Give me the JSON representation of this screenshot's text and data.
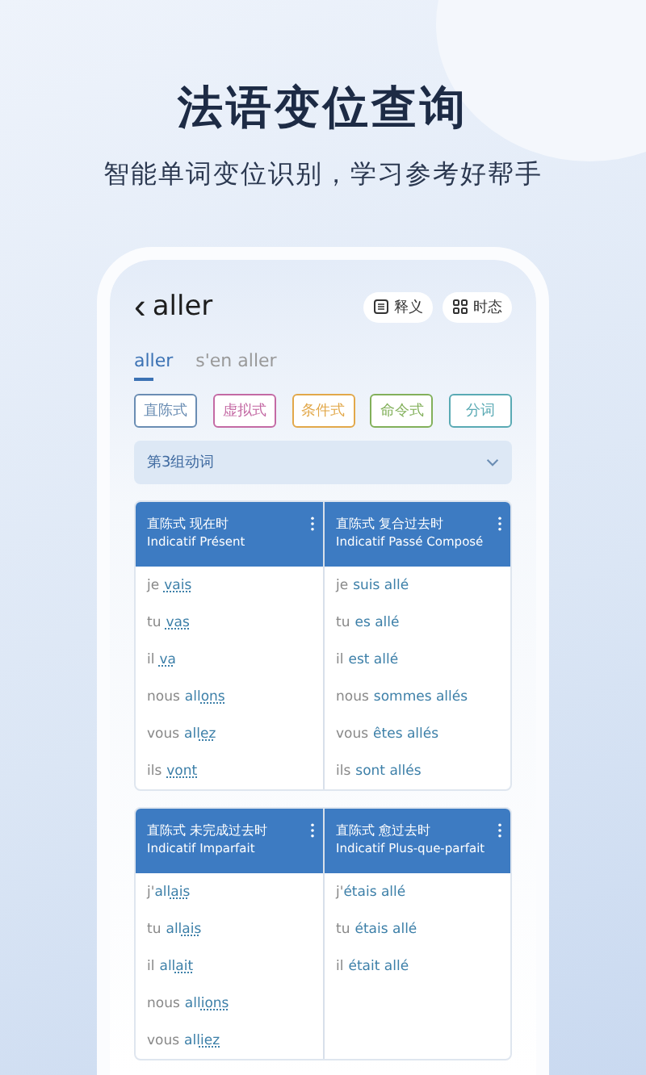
{
  "headline": "法语变位查询",
  "subtitle": "智能单词变位识别，学习参考好帮手",
  "screen": {
    "back_icon": "‹",
    "verb": "aller",
    "actions": [
      {
        "label": "释义"
      },
      {
        "label": "时态"
      }
    ],
    "tabs": [
      {
        "label": "aller",
        "selected": true
      },
      {
        "label": "s'en aller",
        "selected": false
      }
    ],
    "moods": [
      {
        "label": "直陈式",
        "color": "#6a8db3"
      },
      {
        "label": "虚拟式",
        "color": "#c46aa4"
      },
      {
        "label": "条件式",
        "color": "#e2a84a"
      },
      {
        "label": "命令式",
        "color": "#82b05a"
      },
      {
        "label": "分词",
        "color": "#5aaab4"
      }
    ],
    "group_select": {
      "value": "第3组动词"
    },
    "tables": [
      {
        "columns": [
          {
            "title_zh": "直陈式 现在时",
            "title_fr": "Indicatif Présent",
            "forms": [
              {
                "pronoun": "je",
                "ending": "vais"
              },
              {
                "pronoun": "tu",
                "ending": "vas"
              },
              {
                "pronoun": "il",
                "ending": "va"
              },
              {
                "pronoun": "nous",
                "stem": "all",
                "ending": "ons"
              },
              {
                "pronoun": "vous",
                "stem": "all",
                "ending": "ez"
              },
              {
                "pronoun": "ils",
                "ending": "vont"
              }
            ]
          },
          {
            "title_zh": "直陈式 复合过去时",
            "title_fr": "Indicatif Passé Composé",
            "forms": [
              {
                "pronoun": "je",
                "stem": "suis allé"
              },
              {
                "pronoun": "tu",
                "stem": "es allé"
              },
              {
                "pronoun": "il",
                "stem": "est allé"
              },
              {
                "pronoun": "nous",
                "stem": "sommes allés"
              },
              {
                "pronoun": "vous",
                "stem": "êtes allés"
              },
              {
                "pronoun": "ils",
                "stem": "sont allés"
              }
            ]
          }
        ]
      },
      {
        "columns": [
          {
            "title_zh": "直陈式 未完成过去时",
            "title_fr": "Indicatif Imparfait",
            "forms": [
              {
                "pronoun": "j'",
                "joined": true,
                "stem": "all",
                "ending": "ais"
              },
              {
                "pronoun": "tu",
                "stem": "all",
                "ending": "ais"
              },
              {
                "pronoun": "il",
                "stem": "all",
                "ending": "ait"
              },
              {
                "pronoun": "nous",
                "stem": "all",
                "ending": "ions"
              },
              {
                "pronoun": "vous",
                "stem": "all",
                "ending": "iez"
              }
            ]
          },
          {
            "title_zh": "直陈式 愈过去时",
            "title_fr": "Indicatif Plus-que-parfait",
            "forms": [
              {
                "pronoun": "j'",
                "joined": true,
                "stem": "étais allé"
              },
              {
                "pronoun": "tu",
                "stem": "étais allé"
              },
              {
                "pronoun": "il",
                "stem": "était allé"
              }
            ]
          }
        ]
      }
    ]
  }
}
